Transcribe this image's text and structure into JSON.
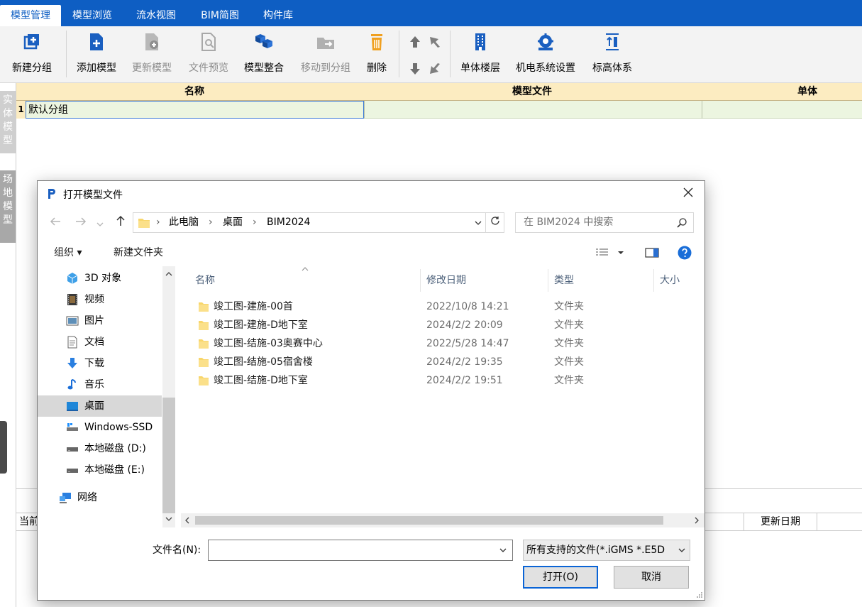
{
  "menu": {
    "tabs": [
      "模型管理",
      "模型浏览",
      "流水视图",
      "BIM简图",
      "构件库"
    ]
  },
  "ribbon": {
    "new_group": "新建分组",
    "add_model": "添加模型",
    "update_model": "更新模型",
    "file_preview": "文件预览",
    "model_merge": "模型整合",
    "move_to_group": "移动到分组",
    "delete": "删除",
    "single_floor": "单体楼层",
    "mep_setup": "机电系统设置",
    "elevation_system": "标高体系"
  },
  "side_tabs": {
    "solid_model": "实体模型",
    "site_model": "场地模型"
  },
  "table": {
    "headers": [
      "名称",
      "模型文件",
      "单体"
    ],
    "rows": [
      {
        "num": "1",
        "name": "默认分组",
        "file": "",
        "unit": ""
      }
    ]
  },
  "bottom_panel": {
    "col_current": "当前",
    "col_update_date": "更新日期"
  },
  "dialog": {
    "title": "打开模型文件",
    "address": [
      "此电脑",
      "桌面",
      "BIM2024"
    ],
    "search_placeholder": "在 BIM2024 中搜索",
    "organize": "组织 ▾",
    "new_folder": "新建文件夹",
    "nav_items": [
      {
        "label": "3D 对象",
        "icon": "cube-icon"
      },
      {
        "label": "视频",
        "icon": "video-icon"
      },
      {
        "label": "图片",
        "icon": "picture-icon"
      },
      {
        "label": "文档",
        "icon": "document-icon"
      },
      {
        "label": "下载",
        "icon": "download-icon"
      },
      {
        "label": "音乐",
        "icon": "music-icon"
      },
      {
        "label": "桌面",
        "icon": "desktop-icon"
      },
      {
        "label": "Windows-SSD",
        "icon": "drive-icon"
      },
      {
        "label": "本地磁盘 (D:)",
        "icon": "drive-icon"
      },
      {
        "label": "本地磁盘 (E:)",
        "icon": "drive-icon"
      },
      {
        "label": "网络",
        "icon": "network-icon"
      }
    ],
    "columns": [
      "名称",
      "修改日期",
      "类型",
      "大小"
    ],
    "files": [
      {
        "name": "竣工图-建施-00首",
        "date": "2022/10/8 14:21",
        "type": "文件夹"
      },
      {
        "name": "竣工图-建施-D地下室",
        "date": "2024/2/2 20:09",
        "type": "文件夹"
      },
      {
        "name": "竣工图-结施-03奥赛中心",
        "date": "2022/5/28 14:47",
        "type": "文件夹"
      },
      {
        "name": "竣工图-结施-05宿舍楼",
        "date": "2024/2/2 19:35",
        "type": "文件夹"
      },
      {
        "name": "竣工图-结施-D地下室",
        "date": "2024/2/2 19:51",
        "type": "文件夹"
      }
    ],
    "filename_label": "文件名(N):",
    "filename_value": "",
    "filetype": "所有支持的文件(*.iGMS *.E5D",
    "open": "打开(O)",
    "cancel": "取消"
  },
  "colors": {
    "menu_bg": "#0e5ec3",
    "table_header": "#fcecc1",
    "table_row": "#ecf5e0",
    "primary_button_border": "#0a64d6"
  }
}
